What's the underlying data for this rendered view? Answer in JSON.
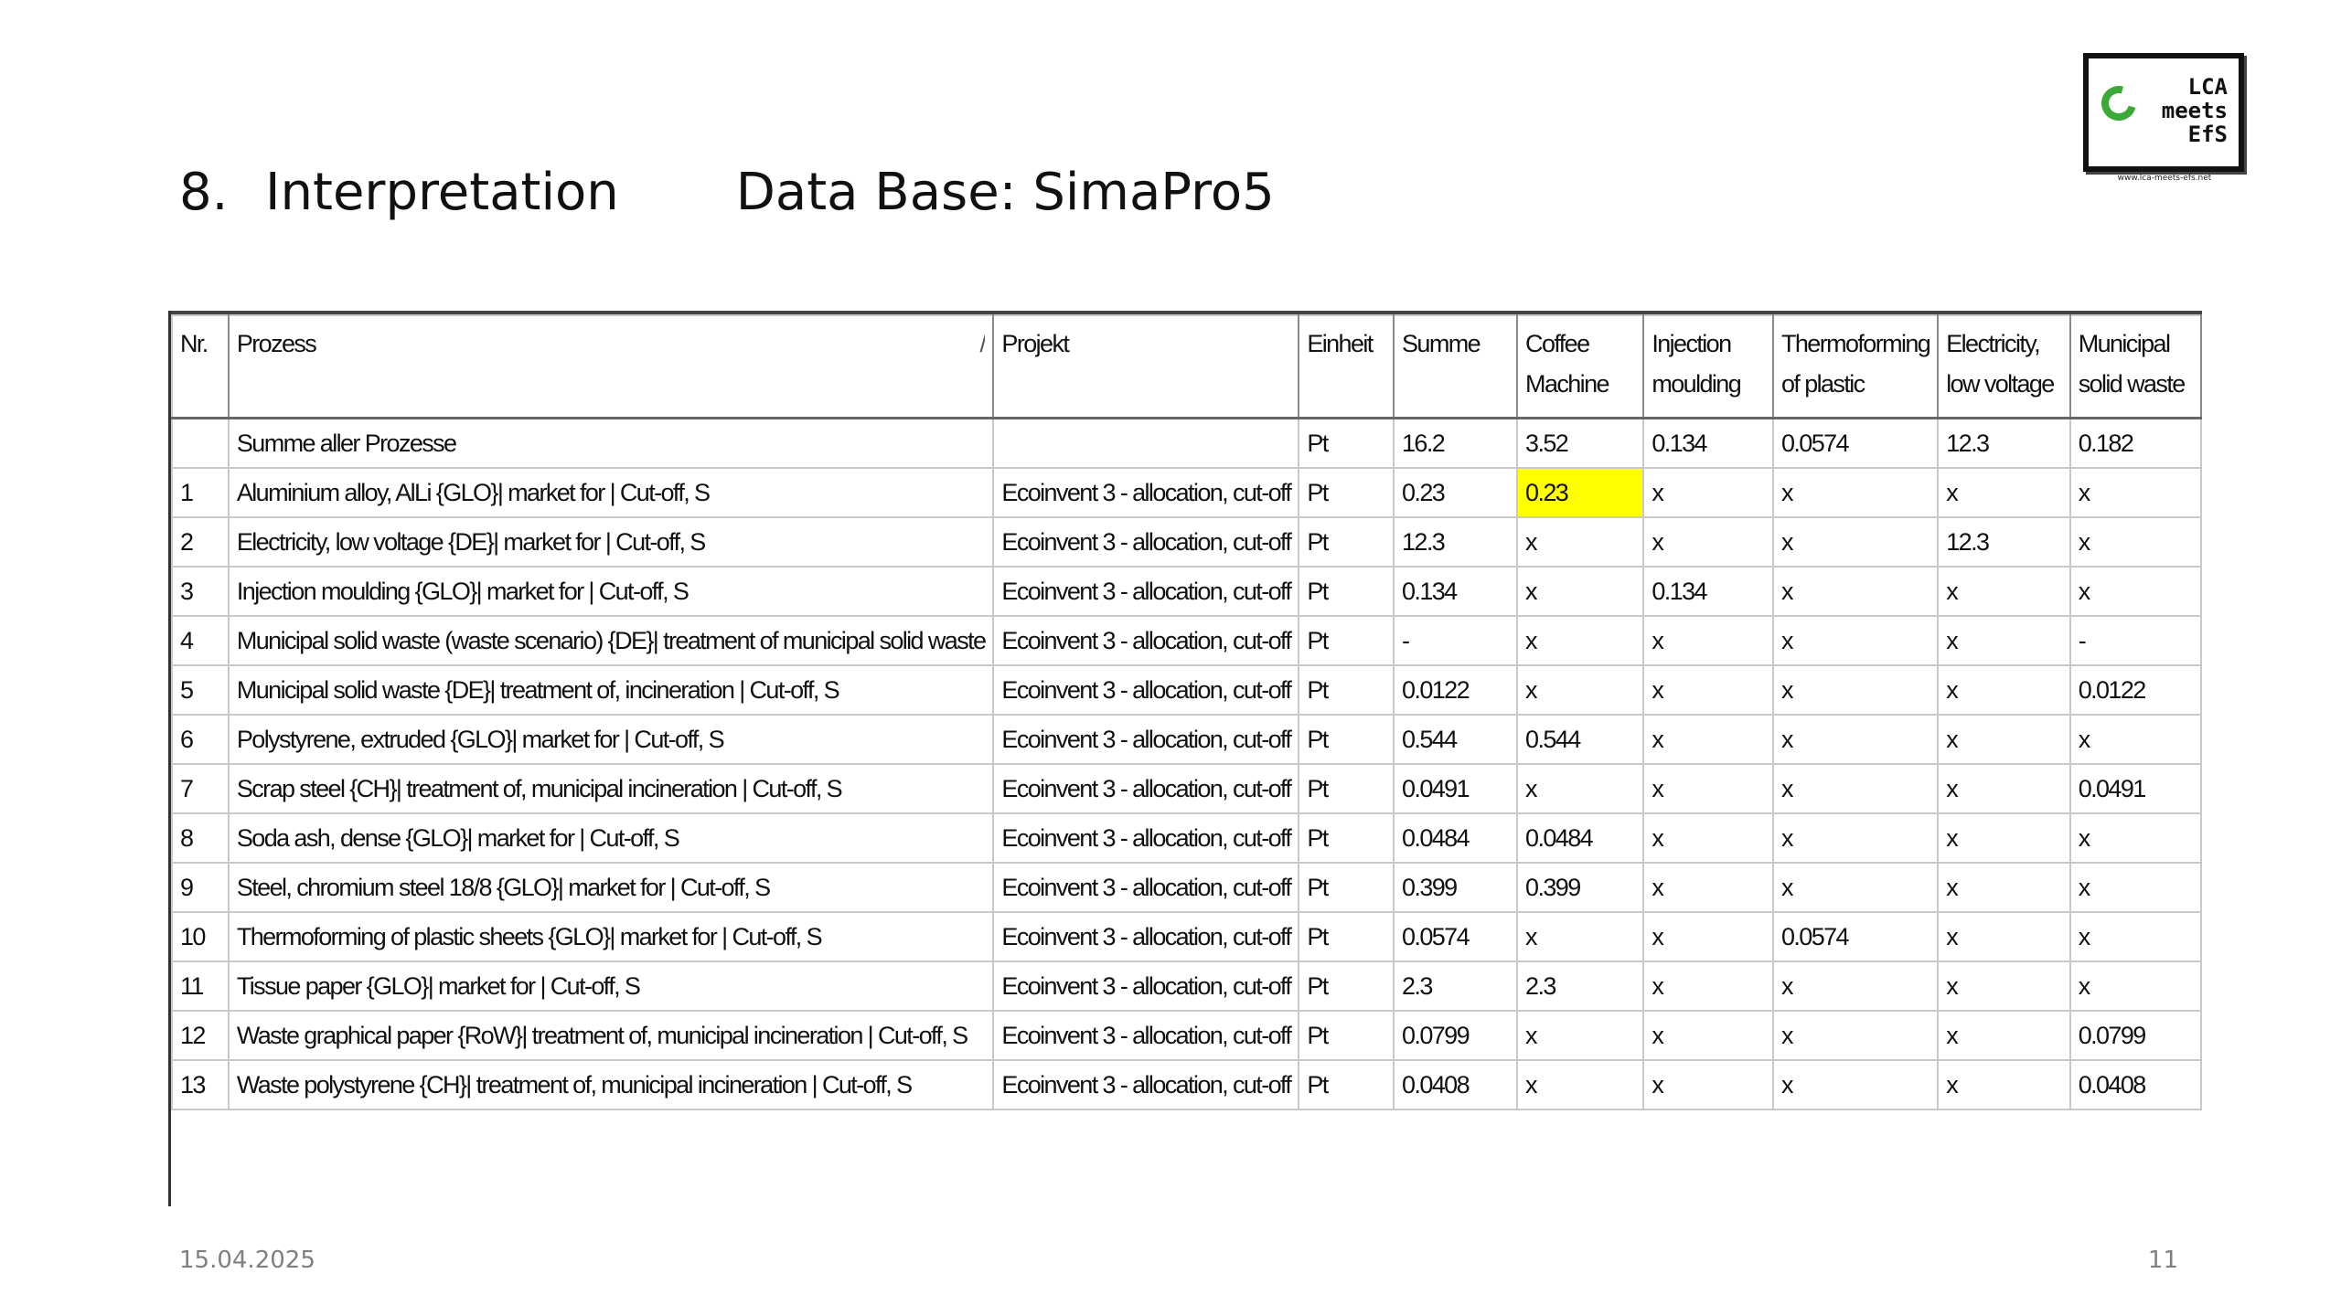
{
  "slide": {
    "section_number": "8.",
    "section_title": "Interpretation",
    "subtitle": "Data Base: SimaPro5",
    "date": "15.04.2025",
    "page_number": "11"
  },
  "logo": {
    "line1": "LCA",
    "line2": "meets",
    "line3": "EfS",
    "url": "www.lca-meets-efs.net",
    "accent_color": "#3aa935"
  },
  "table": {
    "headers": {
      "nr": "Nr.",
      "prozess": "Prozess",
      "sort_mark": "/",
      "projekt": "Projekt",
      "einheit": "Einheit",
      "summe": "Summe",
      "coffee_machine": "Coffee Machine",
      "injection_moulding": "Injection moulding",
      "thermoforming": "Thermoforming of plastic sheets",
      "electricity": "Electricity, low voltage {DE}|",
      "municipal_waste": "Municipal solid waste (waste"
    },
    "highlight_color": "#ffff00",
    "rows": [
      {
        "nr": "",
        "prozess": "Summe aller Prozesse",
        "projekt": "",
        "einheit": "Pt",
        "summe": "16.2",
        "coffee": "3.52",
        "injection": "0.134",
        "thermo": "0.0574",
        "electricity": "12.3",
        "municipal": "0.182"
      },
      {
        "nr": "1",
        "prozess": "Aluminium alloy, AlLi {GLO}| market for | Cut-off, S",
        "projekt": "Ecoinvent 3 - allocation, cut-off",
        "einheit": "Pt",
        "summe": "0.23",
        "coffee": "0.23",
        "injection": "x",
        "thermo": "x",
        "electricity": "x",
        "municipal": "x"
      },
      {
        "nr": "2",
        "prozess": "Electricity, low voltage {DE}| market for | Cut-off, S",
        "projekt": "Ecoinvent 3 - allocation, cut-off",
        "einheit": "Pt",
        "summe": "12.3",
        "coffee": "x",
        "injection": "x",
        "thermo": "x",
        "electricity": "12.3",
        "municipal": "x"
      },
      {
        "nr": "3",
        "prozess": "Injection moulding {GLO}| market for | Cut-off, S",
        "projekt": "Ecoinvent 3 - allocation, cut-off",
        "einheit": "Pt",
        "summe": "0.134",
        "coffee": "x",
        "injection": "0.134",
        "thermo": "x",
        "electricity": "x",
        "municipal": "x"
      },
      {
        "nr": "4",
        "prozess": "Municipal solid waste (waste scenario) {DE}| treatment of municipal solid waste",
        "projekt": "Ecoinvent 3 - allocation, cut-off",
        "einheit": "Pt",
        "summe": "-",
        "coffee": "x",
        "injection": "x",
        "thermo": "x",
        "electricity": "x",
        "municipal": "-"
      },
      {
        "nr": "5",
        "prozess": "Municipal solid waste {DE}| treatment of, incineration | Cut-off, S",
        "projekt": "Ecoinvent 3 - allocation, cut-off",
        "einheit": "Pt",
        "summe": "0.0122",
        "coffee": "x",
        "injection": "x",
        "thermo": "x",
        "electricity": "x",
        "municipal": "0.0122"
      },
      {
        "nr": "6",
        "prozess": "Polystyrene, extruded {GLO}| market for | Cut-off, S",
        "projekt": "Ecoinvent 3 - allocation, cut-off",
        "einheit": "Pt",
        "summe": "0.544",
        "coffee": "0.544",
        "injection": "x",
        "thermo": "x",
        "electricity": "x",
        "municipal": "x"
      },
      {
        "nr": "7",
        "prozess": "Scrap steel {CH}| treatment of, municipal incineration | Cut-off, S",
        "projekt": "Ecoinvent 3 - allocation, cut-off",
        "einheit": "Pt",
        "summe": "0.0491",
        "coffee": "x",
        "injection": "x",
        "thermo": "x",
        "electricity": "x",
        "municipal": "0.0491"
      },
      {
        "nr": "8",
        "prozess": "Soda ash, dense {GLO}| market for | Cut-off, S",
        "projekt": "Ecoinvent 3 - allocation, cut-off",
        "einheit": "Pt",
        "summe": "0.0484",
        "coffee": "0.0484",
        "injection": "x",
        "thermo": "x",
        "electricity": "x",
        "municipal": "x"
      },
      {
        "nr": "9",
        "prozess": "Steel, chromium steel 18/8 {GLO}| market for | Cut-off, S",
        "projekt": "Ecoinvent 3 - allocation, cut-off",
        "einheit": "Pt",
        "summe": "0.399",
        "coffee": "0.399",
        "injection": "x",
        "thermo": "x",
        "electricity": "x",
        "municipal": "x"
      },
      {
        "nr": "10",
        "prozess": "Thermoforming of plastic sheets {GLO}| market for | Cut-off, S",
        "projekt": "Ecoinvent 3 - allocation, cut-off",
        "einheit": "Pt",
        "summe": "0.0574",
        "coffee": "x",
        "injection": "x",
        "thermo": "0.0574",
        "electricity": "x",
        "municipal": "x"
      },
      {
        "nr": "11",
        "prozess": "Tissue paper {GLO}| market for | Cut-off, S",
        "projekt": "Ecoinvent 3 - allocation, cut-off",
        "einheit": "Pt",
        "summe": "2.3",
        "coffee": "2.3",
        "injection": "x",
        "thermo": "x",
        "electricity": "x",
        "municipal": "x"
      },
      {
        "nr": "12",
        "prozess": "Waste graphical paper {RoW}| treatment of, municipal incineration | Cut-off, S",
        "projekt": "Ecoinvent 3 - allocation, cut-off",
        "einheit": "Pt",
        "summe": "0.0799",
        "coffee": "x",
        "injection": "x",
        "thermo": "x",
        "electricity": "x",
        "municipal": "0.0799"
      },
      {
        "nr": "13",
        "prozess": "Waste polystyrene {CH}| treatment of, municipal incineration | Cut-off, S",
        "projekt": "Ecoinvent 3 - allocation, cut-off",
        "einheit": "Pt",
        "summe": "0.0408",
        "coffee": "x",
        "injection": "x",
        "thermo": "x",
        "electricity": "x",
        "municipal": "0.0408"
      }
    ]
  }
}
